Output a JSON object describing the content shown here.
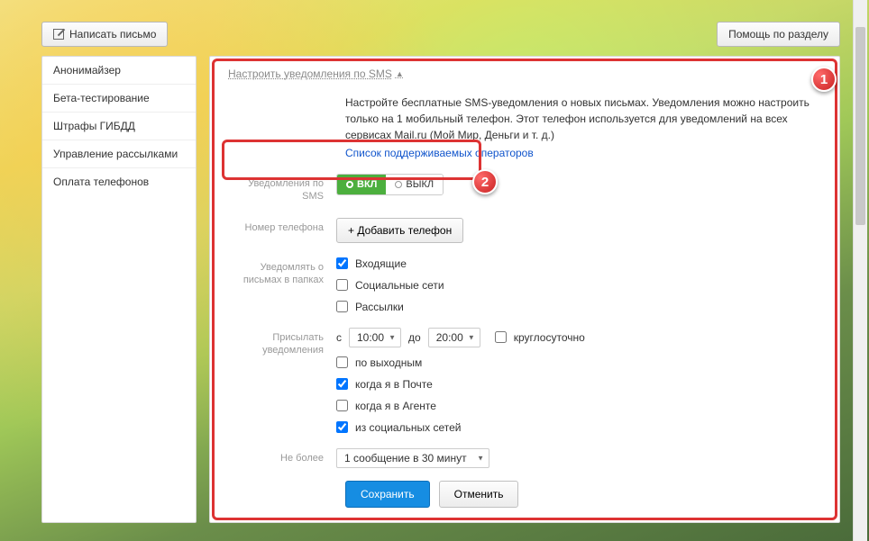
{
  "topbar": {
    "compose": "Написать письмо",
    "help": "Помощь по разделу"
  },
  "sidebar": {
    "items": [
      "Анонимайзер",
      "Бета-тестирование",
      "Штрафы ГИБДД",
      "Управление рассылками",
      "Оплата телефонов"
    ]
  },
  "section": {
    "title": "Настроить уведомления по SMS",
    "desc": "Настройте бесплатные SMS-уведомления о новых письмах. Уведомления можно настроить только на 1 мобильный телефон. Этот телефон используется для уведомлений на всех сервисах Mail.ru (Мой Мир, Деньги и т. д.)",
    "link": "Список поддерживаемых операторов"
  },
  "labels": {
    "sms": "Уведомления по SMS",
    "phone": "Номер телефона",
    "folders": "Уведомлять о письмах в папках",
    "send": "Присылать уведомления",
    "limit": "Не более"
  },
  "toggle": {
    "on": "ВКЛ",
    "off": "ВЫКЛ"
  },
  "buttons": {
    "add_phone": "+  Добавить телефон",
    "save": "Сохранить",
    "cancel": "Отменить"
  },
  "folders": [
    {
      "label": "Входящие",
      "checked": true
    },
    {
      "label": "Социальные сети",
      "checked": false
    },
    {
      "label": "Рассылки",
      "checked": false
    }
  ],
  "time": {
    "from_label": "с",
    "from": "10:00",
    "to_label": "до",
    "to": "20:00",
    "allday": "круглосуточно"
  },
  "send_opts": [
    {
      "label": "по выходным",
      "checked": false
    },
    {
      "label": "когда я в Почте",
      "checked": true
    },
    {
      "label": "когда я в Агенте",
      "checked": false
    },
    {
      "label": "из социальных сетей",
      "checked": true
    }
  ],
  "limit": {
    "value": "1 сообщение в 30 минут"
  },
  "badges": {
    "one": "1",
    "two": "2"
  }
}
